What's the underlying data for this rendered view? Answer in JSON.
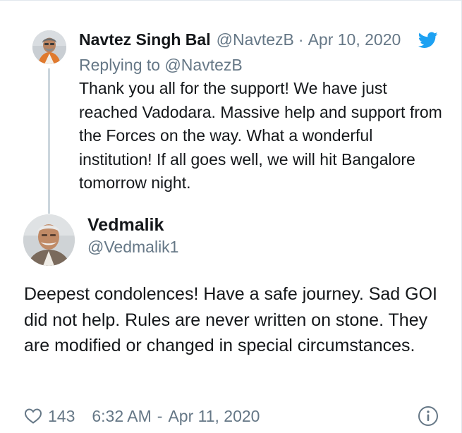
{
  "parent_tweet": {
    "name": "Navtez Singh Bal",
    "handle": "@NavtezB",
    "separator": "·",
    "date": "Apr 10, 2020",
    "replying_to": "Replying to @NavtezB",
    "text": "Thank you all for the support! We have just reached Vadodara. Massive help and support from the Forces on the way. What a wonderful institution! If all goes well, we will hit  Bangalore tomorrow night.",
    "avatar_icon": "user-avatar-photo",
    "brand_icon": "twitter-bird-icon"
  },
  "main_tweet": {
    "name": "Vedmalik",
    "handle": "@Vedmalik1",
    "text": "Deepest condolences! Have a safe journey. Sad GOI did not help. Rules are never written on stone. They are modified or changed in special circumstances.",
    "avatar_icon": "user-avatar-photo"
  },
  "footer": {
    "likes": "143",
    "time": "6:32 AM",
    "separator": "-",
    "date": "Apr 11, 2020",
    "heart_icon": "heart-outline-icon",
    "info_icon": "info-circle-icon"
  },
  "colors": {
    "text_primary": "#14171a",
    "text_secondary": "#657786",
    "twitter_blue": "#1da1f2",
    "thread_line": "#ccd6dd"
  }
}
